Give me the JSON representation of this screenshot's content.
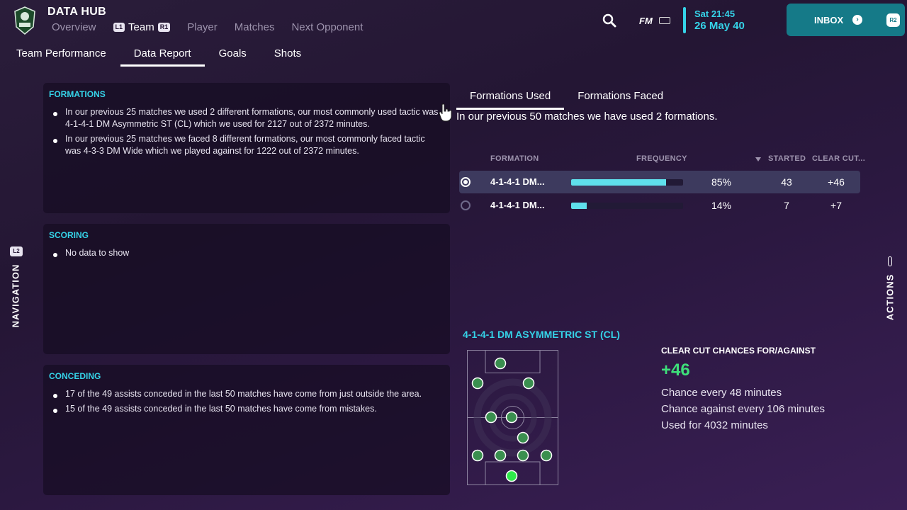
{
  "header": {
    "title": "DATA HUB",
    "nav": [
      {
        "label": "Overview",
        "active": false
      },
      {
        "label": "Team",
        "active": true,
        "left_badge": "L1",
        "right_badge": "R1"
      },
      {
        "label": "Player",
        "active": false
      },
      {
        "label": "Matches",
        "active": false
      },
      {
        "label": "Next Opponent",
        "active": false
      }
    ],
    "fm_label": "FM",
    "date_line1": "Sat 21:45",
    "date_line2": "26 May 40",
    "inbox_label": "INBOX",
    "inbox_badge": "R2",
    "accent_color": "#35d3e8"
  },
  "subnav": [
    {
      "label": "Team Performance",
      "active": false
    },
    {
      "label": "Data Report",
      "active": true
    },
    {
      "label": "Goals",
      "active": false
    },
    {
      "label": "Shots",
      "active": false
    }
  ],
  "side": {
    "navigation_badge": "L2",
    "navigation_label": "NAVIGATION",
    "actions_label": "ACTIONS"
  },
  "panels": {
    "formations": {
      "title": "FORMATIONS",
      "bullets": [
        "In our previous 25 matches we used 2 different formations, our most commonly used tactic was 4-1-4-1 DM Asymmetric ST (CL) which we used for 2127 out of 2372 minutes.",
        "In our previous 25 matches we faced 8 different formations, our most commonly faced tactic was 4-3-3 DM Wide which we played against for 1222 out of 2372 minutes."
      ]
    },
    "scoring": {
      "title": "SCORING",
      "bullets": [
        "No data to show"
      ]
    },
    "conceding": {
      "title": "CONCEDING",
      "bullets": [
        "17 of the 49 assists conceded in the last 50 matches have come from just outside the area.",
        "15 of the 49 assists conceded in the last 50 matches have come from mistakes."
      ]
    }
  },
  "formations": {
    "tabs": [
      {
        "label": "Formations Used",
        "active": true
      },
      {
        "label": "Formations Faced",
        "active": false
      }
    ],
    "summary": "In our previous 50 matches we have used 2 formations.",
    "columns": {
      "formation": "FORMATION",
      "frequency": "FREQUENCY",
      "started": "STARTED",
      "clear_cut": "CLEAR CUT..."
    },
    "rows": [
      {
        "name": "4-1-4-1 DM...",
        "frequency": "85%",
        "frequency_value": 0.85,
        "started": "43",
        "clear_cut": "+46",
        "selected": true
      },
      {
        "name": "4-1-4-1 DM...",
        "frequency": "14%",
        "frequency_value": 0.14,
        "started": "7",
        "clear_cut": "+7",
        "selected": false
      }
    ]
  },
  "detail": {
    "formation_title": "4-1-4-1 DM ASYMMETRIC ST (CL)",
    "cc_title": "CLEAR CUT CHANCES FOR/AGAINST",
    "cc_value": "+46",
    "lines": [
      "Chance every 48 minutes",
      "Chance against every 106 minutes",
      "Used for 4032 minutes"
    ]
  }
}
